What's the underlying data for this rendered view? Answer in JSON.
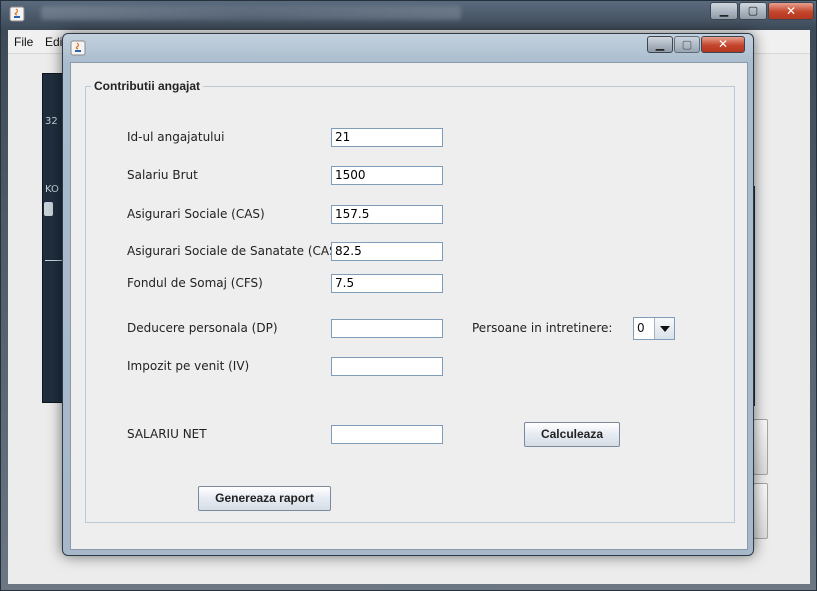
{
  "main_window": {
    "menu": {
      "file": "File",
      "edit": "Edi"
    }
  },
  "dialog": {
    "section_title": "Contributii angajat",
    "fields": [
      {
        "label": "Id-ul angajatului",
        "value": "21"
      },
      {
        "label": "Salariu Brut",
        "value": "1500"
      },
      {
        "label": "Asigurari Sociale (CAS)",
        "value": "157.5"
      },
      {
        "label": "Asigurari Sociale de Sanatate (CASS)",
        "value": "82.5"
      },
      {
        "label": "Fondul de Somaj (CFS)",
        "value": "7.5"
      },
      {
        "label": "Deducere personala (DP)",
        "value": ""
      },
      {
        "label": "Impozit pe venit (IV)",
        "value": ""
      },
      {
        "label": "SALARIU NET",
        "value": ""
      }
    ],
    "dependents": {
      "label": "Persoane in intretinere:",
      "selected": "0"
    },
    "buttons": {
      "calculate": "Calculeaza",
      "report": "Genereaza raport"
    }
  },
  "icons": {
    "window_controls": [
      "minimize-icon",
      "maximize-icon",
      "close-icon"
    ],
    "app": "java-app-icon"
  }
}
